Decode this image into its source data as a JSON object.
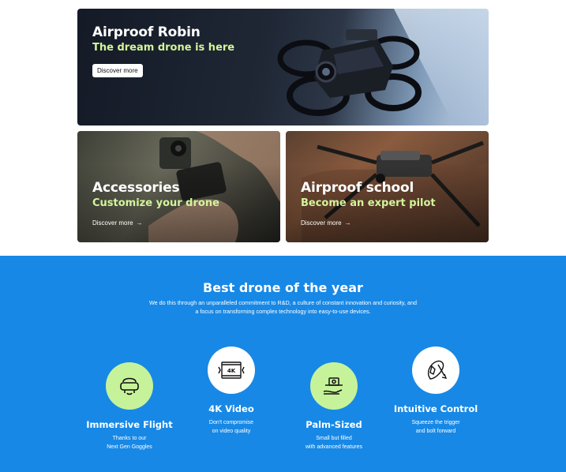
{
  "hero": {
    "title": "Airproof Robin",
    "subtitle": "The dream drone is here",
    "button_label": "Discover more"
  },
  "cards": [
    {
      "title": "Accessories",
      "subtitle": "Customize your drone",
      "link_label": "Discover more",
      "arrow": "→"
    },
    {
      "title": "Airproof school",
      "subtitle": "Become an expert pilot",
      "link_label": "Discover more",
      "arrow": "→"
    }
  ],
  "section": {
    "heading": "Best drone of the year",
    "lead_line1": "We do this through an unparalleled commitment to R&D, a culture of constant innovation and curiosity, and",
    "lead_line2": "a focus on transforming complex technology into easy-to-use devices."
  },
  "features": [
    {
      "title": "Immersive Flight",
      "line1": "Thanks to our",
      "line2": "Next Gen Goggles",
      "icon": "goggles-icon"
    },
    {
      "title": "4K Video",
      "line1": "Don't compromise",
      "line2": "on video quality",
      "icon": "4k-video-icon",
      "badge": "4K"
    },
    {
      "title": "Palm-Sized",
      "line1": "Small but filled",
      "line2": "with advanced features",
      "icon": "palm-drone-icon"
    },
    {
      "title": "Intuitive Control",
      "line1": "Squeeze the trigger",
      "line2": "and bolt forward",
      "icon": "hand-control-icon"
    }
  ],
  "colors": {
    "accent_lime": "#c6f39a",
    "subtitle_lime": "#d3f59a",
    "section_blue": "#1788e6"
  }
}
